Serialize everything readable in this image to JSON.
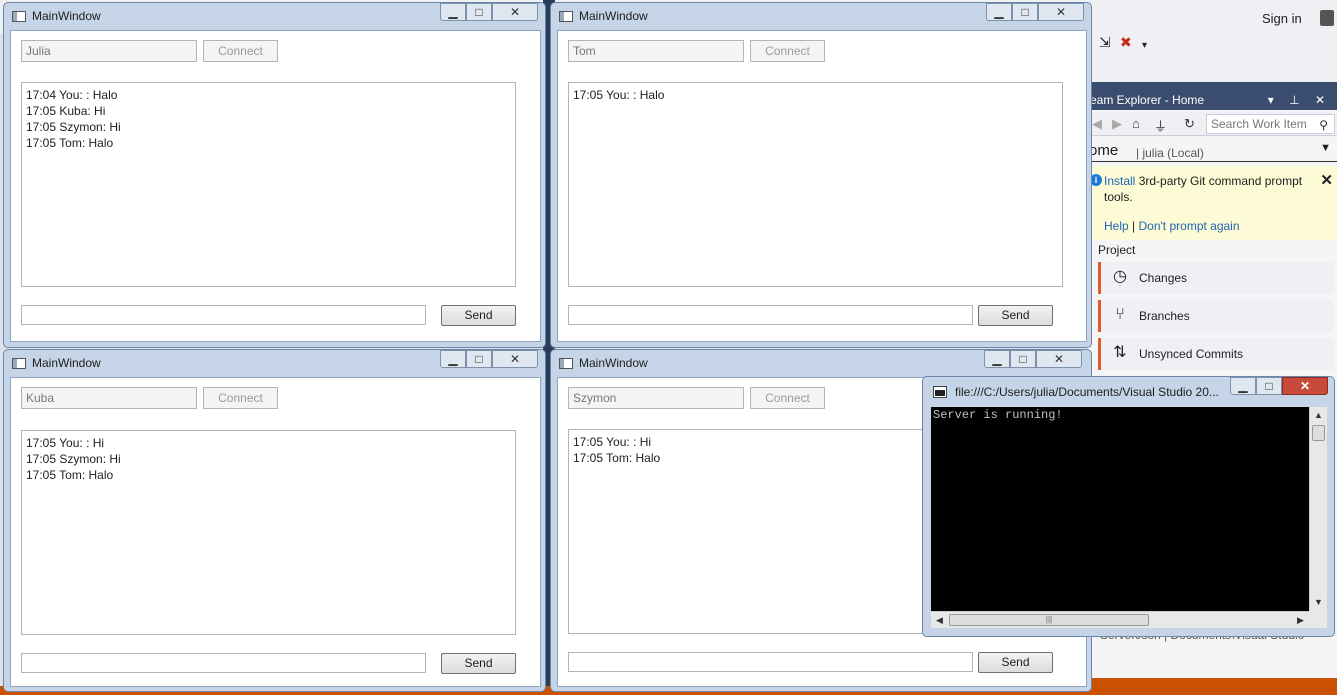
{
  "vs": {
    "sign_in": "Sign in"
  },
  "team_explorer": {
    "title": "eam Explorer - Home",
    "search_placeholder": "Search Work Item",
    "home_title": "ome",
    "home_context": "| julia (Local)",
    "notice": {
      "install_link": "Install",
      "text": " 3rd-party Git command prompt tools.",
      "help_link": "Help",
      "separator": "|",
      "dont_prompt_link": "Don't prompt again"
    },
    "project_label": "Project",
    "items": [
      {
        "label": "Changes",
        "icon": "clock-icon"
      },
      {
        "label": "Branches",
        "icon": "branch-icon"
      },
      {
        "label": "Unsynced Commits",
        "icon": "sync-arrows-icon"
      }
    ],
    "bottom_path": "ServerJson | Documents\\Visual Studio"
  },
  "windows": [
    {
      "title": "MainWindow",
      "name": "Julia",
      "connect": "Connect",
      "send": "Send",
      "messages": [
        "17:04 You: : Halo",
        "17:05 Kuba: Hi",
        "17:05 Szymon: Hi",
        "17:05 Tom: Halo"
      ]
    },
    {
      "title": "MainWindow",
      "name": "Tom",
      "connect": "Connect",
      "send": "Send",
      "messages": [
        "17:05 You: : Halo"
      ]
    },
    {
      "title": "MainWindow",
      "name": "Kuba",
      "connect": "Connect",
      "send": "Send",
      "messages": [
        "17:05 You: : Hi",
        "17:05 Szymon: Hi",
        "17:05 Tom: Halo"
      ]
    },
    {
      "title": "MainWindow",
      "name": "Szymon",
      "connect": "Connect",
      "send": "Send",
      "messages": [
        "17:05 You: : Hi",
        "17:05 Tom: Halo"
      ]
    }
  ],
  "console": {
    "title": "file:///C:/Users/julia/Documents/Visual Studio 20...",
    "output": "Server is running!"
  }
}
